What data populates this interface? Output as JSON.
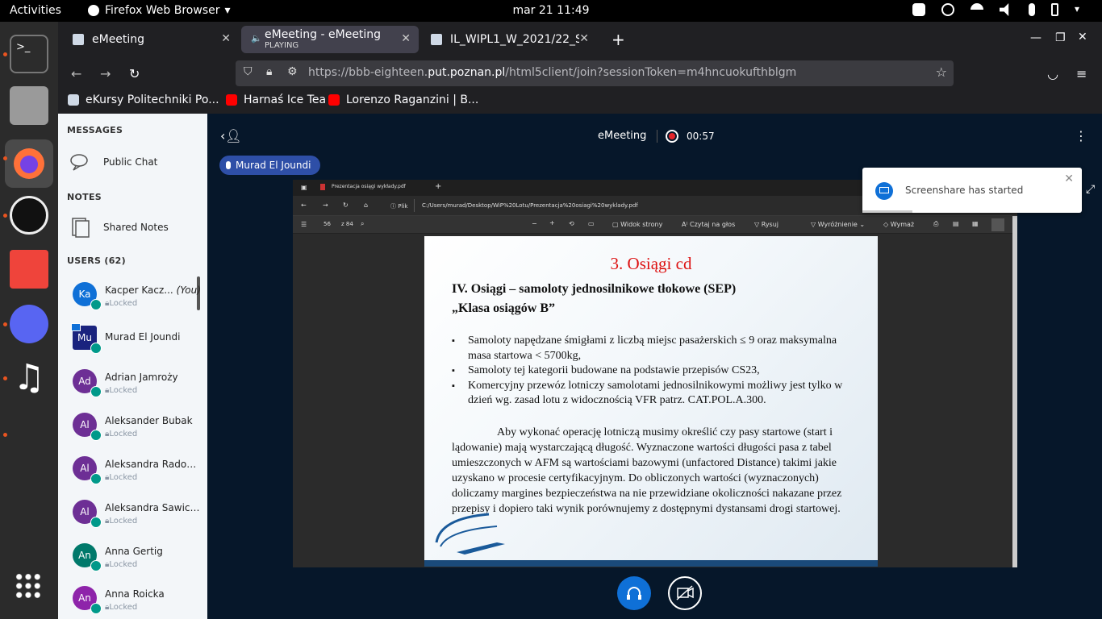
{
  "topbar": {
    "activities": "Activities",
    "app_name": "Firefox Web Browser",
    "clock": "mar 21  11:49"
  },
  "browser": {
    "tabs": [
      {
        "title": "eMeeting",
        "sub": ""
      },
      {
        "title": "eMeeting - eMeeting",
        "sub": "PLAYING"
      },
      {
        "title": "IL_WIPL1_W_2021/22_St",
        "sub": ""
      }
    ],
    "url_host": "https://bbb-eighteen.",
    "url_domain": "put.poznan.pl",
    "url_path": "/html5client/join?sessionToken=m4hncuokufthblgm",
    "bookmarks": [
      "eKursy Politechniki Po...",
      "Harnaś Ice Tea",
      "Lorenzo Raganzini | B..."
    ]
  },
  "sidebar": {
    "messages_header": "MESSAGES",
    "public_chat": "Public Chat",
    "notes_header": "NOTES",
    "shared_notes": "Shared Notes",
    "users_header": "USERS (62)",
    "you_label": "(You)",
    "users": [
      {
        "initials": "Ka",
        "name": "Kacper Kacz...",
        "status": "Locked"
      },
      {
        "initials": "Mu",
        "name": "Murad El Joundi",
        "status": ""
      },
      {
        "initials": "Ad",
        "name": "Adrian Jamroży",
        "status": "Locked"
      },
      {
        "initials": "Al",
        "name": "Aleksander Bubak",
        "status": "Locked"
      },
      {
        "initials": "Al",
        "name": "Aleksandra Radow...",
        "status": "Locked"
      },
      {
        "initials": "Al",
        "name": "Aleksandra Sawicka",
        "status": "Locked"
      },
      {
        "initials": "An",
        "name": "Anna Gertig",
        "status": "Locked"
      },
      {
        "initials": "An",
        "name": "Anna Roicka",
        "status": "Locked"
      }
    ]
  },
  "meeting": {
    "title": "eMeeting",
    "rec_time": "00:57",
    "presenter": "Murad El Joundi",
    "notification": "Screenshare has started"
  },
  "shared_screen": {
    "tab_title": "Prezentacja osiągi wykłady.pdf",
    "file_label": "Plik",
    "file_path": "C:/Users/murad/Desktop/WiP%20Lotu/Prezentacja%20osiagi%20wyklady.pdf",
    "page_num": "56",
    "page_total": "z 84",
    "tools": [
      "Widok strony",
      "Czytaj na głos",
      "Rysuj",
      "Wyróżnienie",
      "Wymaż"
    ],
    "slide": {
      "title": "3. Osiągi cd",
      "heading1": "IV.  Osiągi – samoloty jednosilnikowe tłokowe (SEP)",
      "heading2": "„Klasa osiągów B”",
      "bullets": [
        "Samoloty napędzane śmigłami z liczbą miejsc pasażerskich ≤ 9 oraz maksymalna masa startowa < 5700kg,",
        "Samoloty tej kategorii budowane na podstawie przepisów CS23,",
        "Komercyjny przewóz lotniczy samolotami jednosilnikowymi możliwy jest tylko w dzień wg. zasad lotu z widocznością VFR patrz. CAT.POL.A.300."
      ],
      "paragraph": "Aby wykonać operację lotniczą musimy określić czy pasy startowe (start i lądowanie) mają wystarczającą długość. Wyznaczone wartości długości pasa z tabel umieszczonych w AFM są wartościami bazowymi (unfactored Distance) takimi jakie uzyskano w procesie certyfikacyjnym. Do obliczonych wartości (wyznaczonych) doliczamy margines bezpieczeństwa na nie przewidziane okoliczności nakazane przez przepisy i dopiero taki wynik porównujemy z dostępnymi dystansami drogi startowej."
    }
  },
  "colors": {
    "accent": "#0f70d7",
    "rec": "#e5252a",
    "bg": "#06172a"
  }
}
